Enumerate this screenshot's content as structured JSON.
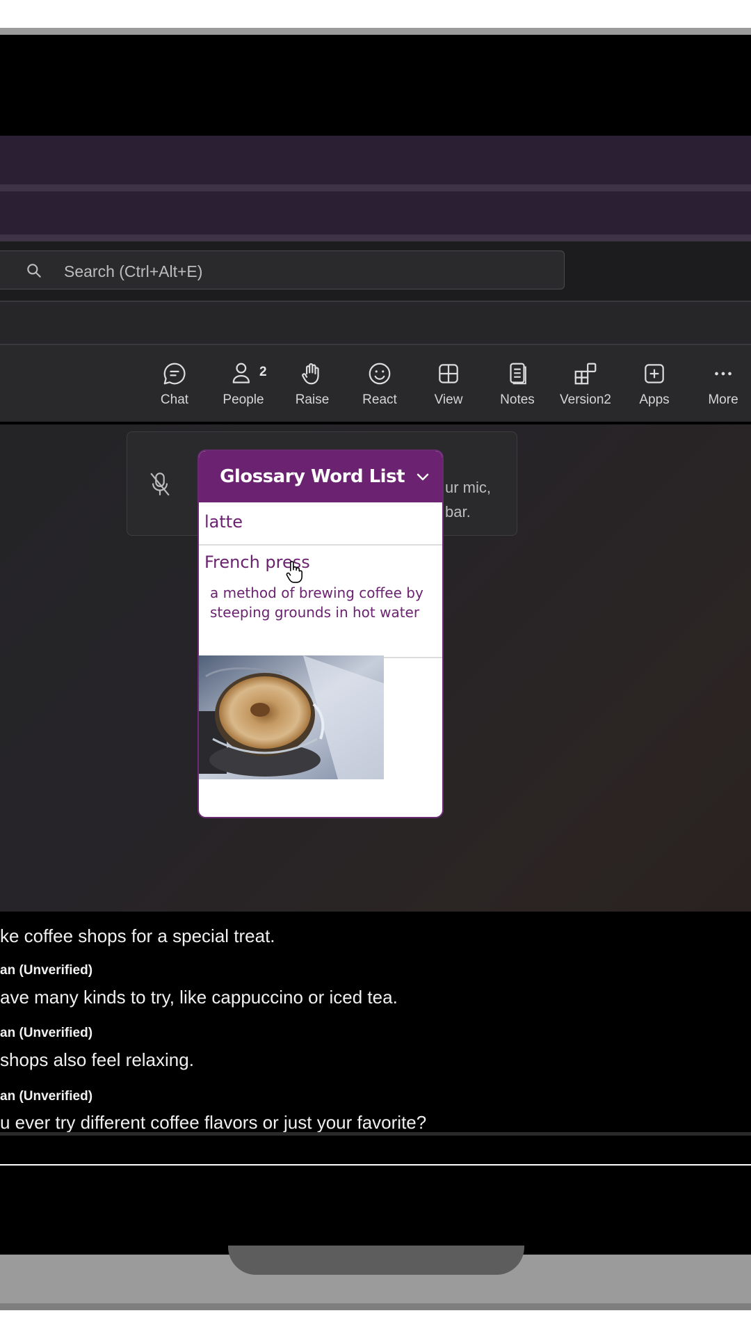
{
  "search": {
    "placeholder": "Search (Ctrl+Alt+E)"
  },
  "toolbar": {
    "buttons": [
      {
        "label": "Chat",
        "icon": "chat-icon"
      },
      {
        "label": "People",
        "icon": "people-icon",
        "count": "2"
      },
      {
        "label": "Raise",
        "icon": "raise-hand-icon"
      },
      {
        "label": "React",
        "icon": "react-icon"
      },
      {
        "label": "View",
        "icon": "view-icon"
      },
      {
        "label": "Notes",
        "icon": "notes-icon"
      },
      {
        "label": "Version2",
        "icon": "apps-grid-icon"
      },
      {
        "label": "Apps",
        "icon": "add-app-icon"
      },
      {
        "label": "More",
        "icon": "more-icon"
      }
    ]
  },
  "mic_notice": {
    "fragments": [
      "ur mic,",
      "bar."
    ],
    "icon": "mic-off-icon"
  },
  "glossary": {
    "title": "Glossary Word List",
    "words": [
      {
        "term": "latte"
      },
      {
        "term": "French press",
        "definition": "a method of brewing coffee by steeping grounds in hot water"
      }
    ],
    "image": "french-press-coffee-photo"
  },
  "captions": {
    "lines": [
      {
        "text": "ke coffee shops for a special treat."
      },
      {
        "speaker": "an (Unverified)",
        "text": "ave many kinds to try, like cappuccino or iced tea."
      },
      {
        "speaker": "an (Unverified)",
        "text": "shops also feel relaxing."
      },
      {
        "speaker": "an (Unverified)",
        "text": "u ever try different coffee flavors or just your favorite?"
      }
    ]
  },
  "colors": {
    "accent_purple": "#6b2270",
    "band_purple": "#2b1f34",
    "toolbar_bg": "#29292c"
  }
}
